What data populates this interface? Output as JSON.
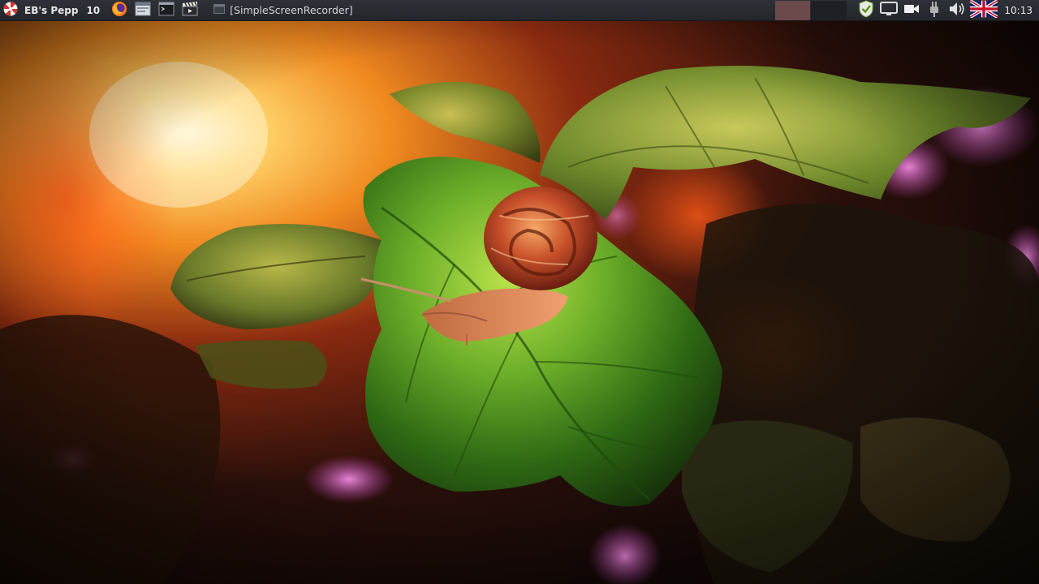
{
  "taskbar": {
    "menu_label": "EB's Pepp",
    "workspace": "10",
    "launchers": [
      "firefox-icon",
      "file-manager-icon",
      "terminal-icon",
      "video-editor-icon"
    ],
    "task_title": "[SimpleScreenRecorder]",
    "tray_icons": [
      "shield-icon",
      "display-icon",
      "camera-icon",
      "power-plug-icon",
      "volume-icon",
      "uk-flag-icon"
    ],
    "clock": "10:13"
  },
  "colors": {
    "taskbar_bg": "#2a2d32",
    "cpu_graph": "#6b4a4c",
    "menu_logo": "#d9342b"
  },
  "wallpaper": {
    "subject": "snail-on-green-leaf"
  }
}
